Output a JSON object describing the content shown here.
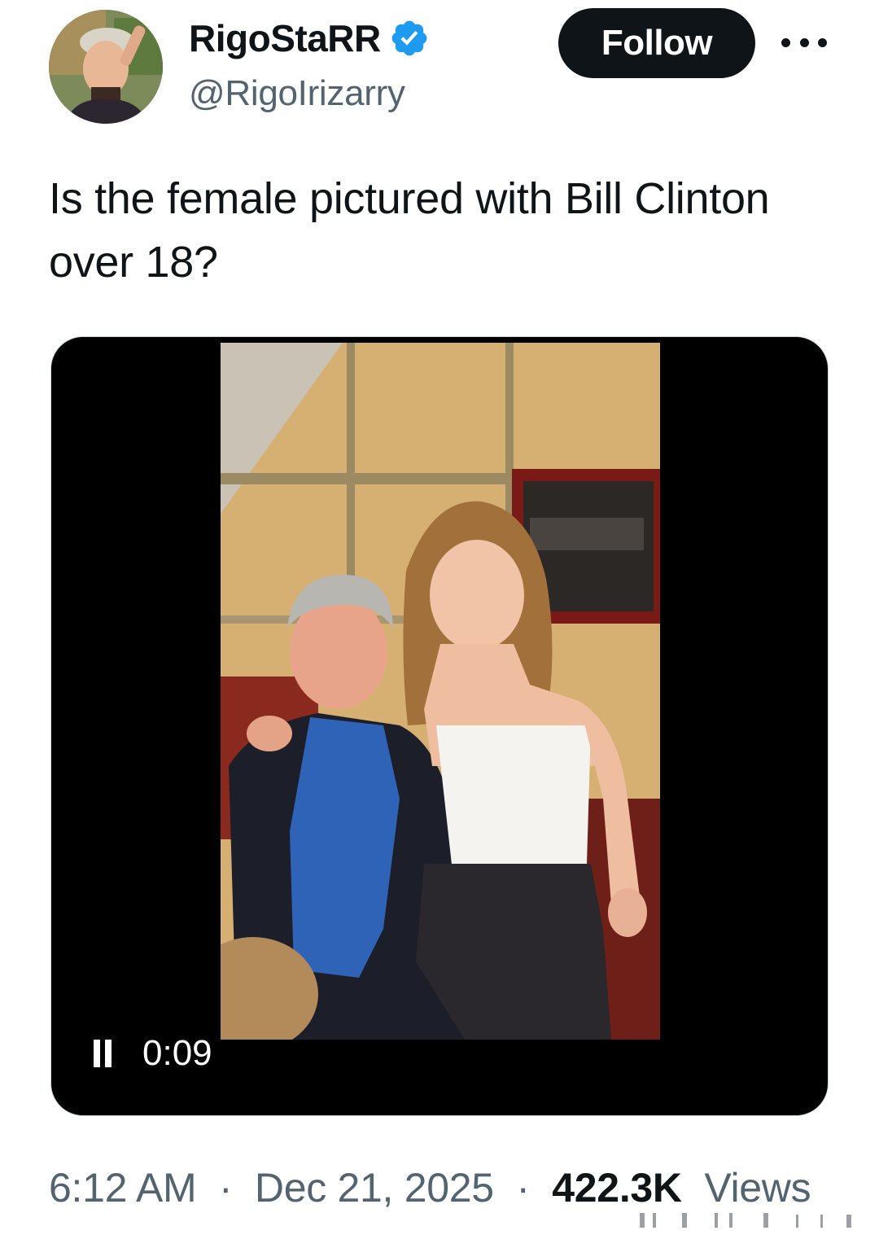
{
  "author": {
    "display_name": "RigoStaRR",
    "handle": "@RigoIrizarry",
    "verified": true
  },
  "header": {
    "follow_label": "Follow",
    "more_icon": "more-horizontal-icon"
  },
  "tweet": {
    "text": "Is the female pictured with Bill Clinton over 18?"
  },
  "media": {
    "type": "video",
    "state": "playing",
    "time": "0:09"
  },
  "meta": {
    "time": "6:12 AM",
    "separator": "·",
    "date": "Dec 21, 2025",
    "views_count": "422.3K",
    "views_label": "Views"
  },
  "colors": {
    "text_primary": "#0f1419",
    "text_secondary": "#536471",
    "verified_blue": "#1d9bf0",
    "button_bg": "#0f1419",
    "media_bg": "#000000"
  }
}
